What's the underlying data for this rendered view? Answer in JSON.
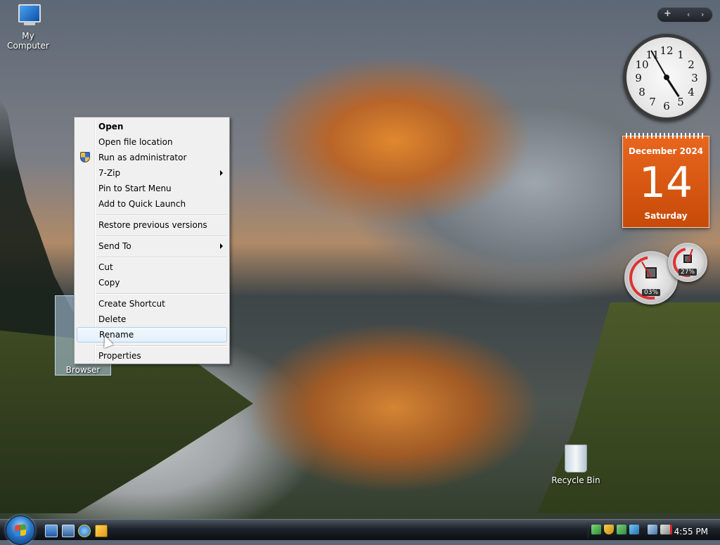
{
  "desktop": {
    "icons": {
      "my_computer": "My Computer",
      "recycle_bin": "Recycle Bin",
      "ie_selected": "Browser"
    }
  },
  "context_menu": {
    "items": [
      {
        "label": "Open",
        "bold": true
      },
      {
        "label": "Open file location"
      },
      {
        "label": "Run as administrator",
        "icon": "uac-shield-icon"
      },
      {
        "label": "7-Zip",
        "submenu": true
      },
      {
        "label": "Pin to Start Menu"
      },
      {
        "label": "Add to Quick Launch"
      },
      {
        "label": "Restore previous versions"
      },
      {
        "label": "Send To",
        "submenu": true
      },
      {
        "label": "Cut"
      },
      {
        "label": "Copy"
      },
      {
        "label": "Create Shortcut"
      },
      {
        "label": "Delete"
      },
      {
        "label": "Rename",
        "highlighted": true
      },
      {
        "label": "Properties"
      }
    ]
  },
  "gadgets": {
    "clock_numbers": [
      "12",
      "1",
      "2",
      "3",
      "4",
      "5",
      "6",
      "7",
      "8",
      "9",
      "10",
      "11"
    ],
    "clock_time": "4:55",
    "calendar": {
      "month_year": "December 2024",
      "day": "14",
      "weekday": "Saturday"
    },
    "cpu_meter": {
      "cpu_percent": "03%",
      "memory_percent": "27%"
    },
    "toolbar_add": "+",
    "toolbar_prev": "‹",
    "toolbar_next": "›"
  },
  "taskbar": {
    "clock": "4:55 PM",
    "quick_launch": [
      "show-desktop-icon",
      "switch-windows-icon",
      "internet-explorer-icon",
      "media-player-icon"
    ],
    "tray_icons": [
      "network-status-icon",
      "security-shield-icon",
      "safely-remove-icon",
      "update-icon",
      "network-icon",
      "volume-muted-icon"
    ]
  },
  "colors": {
    "menu_background": "#f0f0f0",
    "menu_highlight_border": "#aecff7",
    "calendar_orange": "#e8661e"
  }
}
